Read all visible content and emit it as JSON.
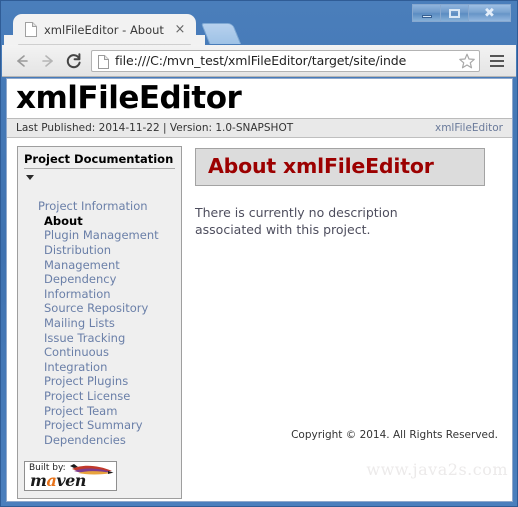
{
  "window": {
    "buttons": {
      "minimize": "minimize",
      "maximize": "maximize",
      "close": "close"
    }
  },
  "browser": {
    "tab": {
      "title": "xmlFileEditor - About",
      "close_label": "×",
      "favicon": "page-icon"
    },
    "new_tab_label": "",
    "toolbar": {
      "back": "←",
      "forward": "→",
      "reload": "C",
      "url": "file:///C:/mvn_test/xmlFileEditor/target/site/inde",
      "star": "star-icon",
      "menu": "menu-icon"
    }
  },
  "page": {
    "banner_title": "xmlFileEditor",
    "publish": {
      "left": "Last Published: 2014-11-22  |  Version: 1.0-SNAPSHOT",
      "right_link": "xmlFileEditor"
    },
    "sidebar": {
      "heading": "Project Documentation",
      "items": [
        {
          "label": "Project Information",
          "type": "top",
          "current": false
        },
        {
          "label": "About",
          "type": "child",
          "current": true
        },
        {
          "label": "Plugin Management",
          "type": "child",
          "current": false
        },
        {
          "label": "Distribution\n  Management",
          "type": "child",
          "current": false
        },
        {
          "label": "Dependency\n  Information",
          "type": "child",
          "current": false
        },
        {
          "label": "Source Repository",
          "type": "child",
          "current": false
        },
        {
          "label": "Mailing Lists",
          "type": "child",
          "current": false
        },
        {
          "label": "Issue Tracking",
          "type": "child",
          "current": false
        },
        {
          "label": "Continuous\n  Integration",
          "type": "child",
          "current": false
        },
        {
          "label": "Project Plugins",
          "type": "child",
          "current": false
        },
        {
          "label": "Project License",
          "type": "child",
          "current": false
        },
        {
          "label": "Project Team",
          "type": "child",
          "current": false
        },
        {
          "label": "Project Summary",
          "type": "child",
          "current": false
        },
        {
          "label": "Dependencies",
          "type": "child",
          "current": false
        }
      ],
      "maven_badge": {
        "built_by": "Built by:",
        "name_pre": "m",
        "name_accent": "a",
        "name_post": "ven"
      }
    },
    "main": {
      "section_title": "About xmlFileEditor",
      "paragraph": "There is currently no description associated with this project."
    },
    "footer": {
      "copyright": "Copyright © 2014. All Rights Reserved.",
      "watermark": "www.java2s.com"
    }
  },
  "colors": {
    "heading_red": "#9c0000",
    "link_blue": "#6a7fa8",
    "frame_blue": "#4a7ebb",
    "maven_orange": "#e8731a"
  }
}
